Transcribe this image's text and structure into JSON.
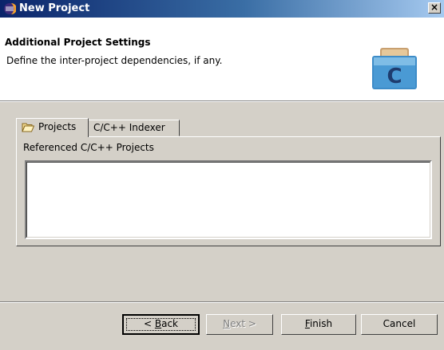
{
  "window": {
    "title": "New Project",
    "close_symbol": "×",
    "icon": "eclipse-icon"
  },
  "header": {
    "title": "Additional Project Settings",
    "description": "Define the inter-project dependencies, if any.",
    "logo_letter": "C",
    "logo_icon": "c-project-icon"
  },
  "tabs": [
    {
      "label": "Projects",
      "icon": "folder-open-icon",
      "selected": true
    },
    {
      "label": "C/C++ Indexer",
      "selected": false
    }
  ],
  "panel": {
    "label": "Referenced C/C++ Projects",
    "items": []
  },
  "buttons": {
    "back": {
      "pre": "< ",
      "mnemonic": "B",
      "post": "ack",
      "enabled": true
    },
    "next": {
      "pre": "",
      "mnemonic": "N",
      "post": "ext >",
      "enabled": false
    },
    "finish": {
      "pre": "",
      "mnemonic": "F",
      "post": "inish",
      "enabled": true
    },
    "cancel": {
      "label": "Cancel",
      "enabled": true
    }
  },
  "colors": {
    "titlebar_start": "#0a246a",
    "titlebar_end": "#a6caf0",
    "face": "#d4d0c8"
  }
}
